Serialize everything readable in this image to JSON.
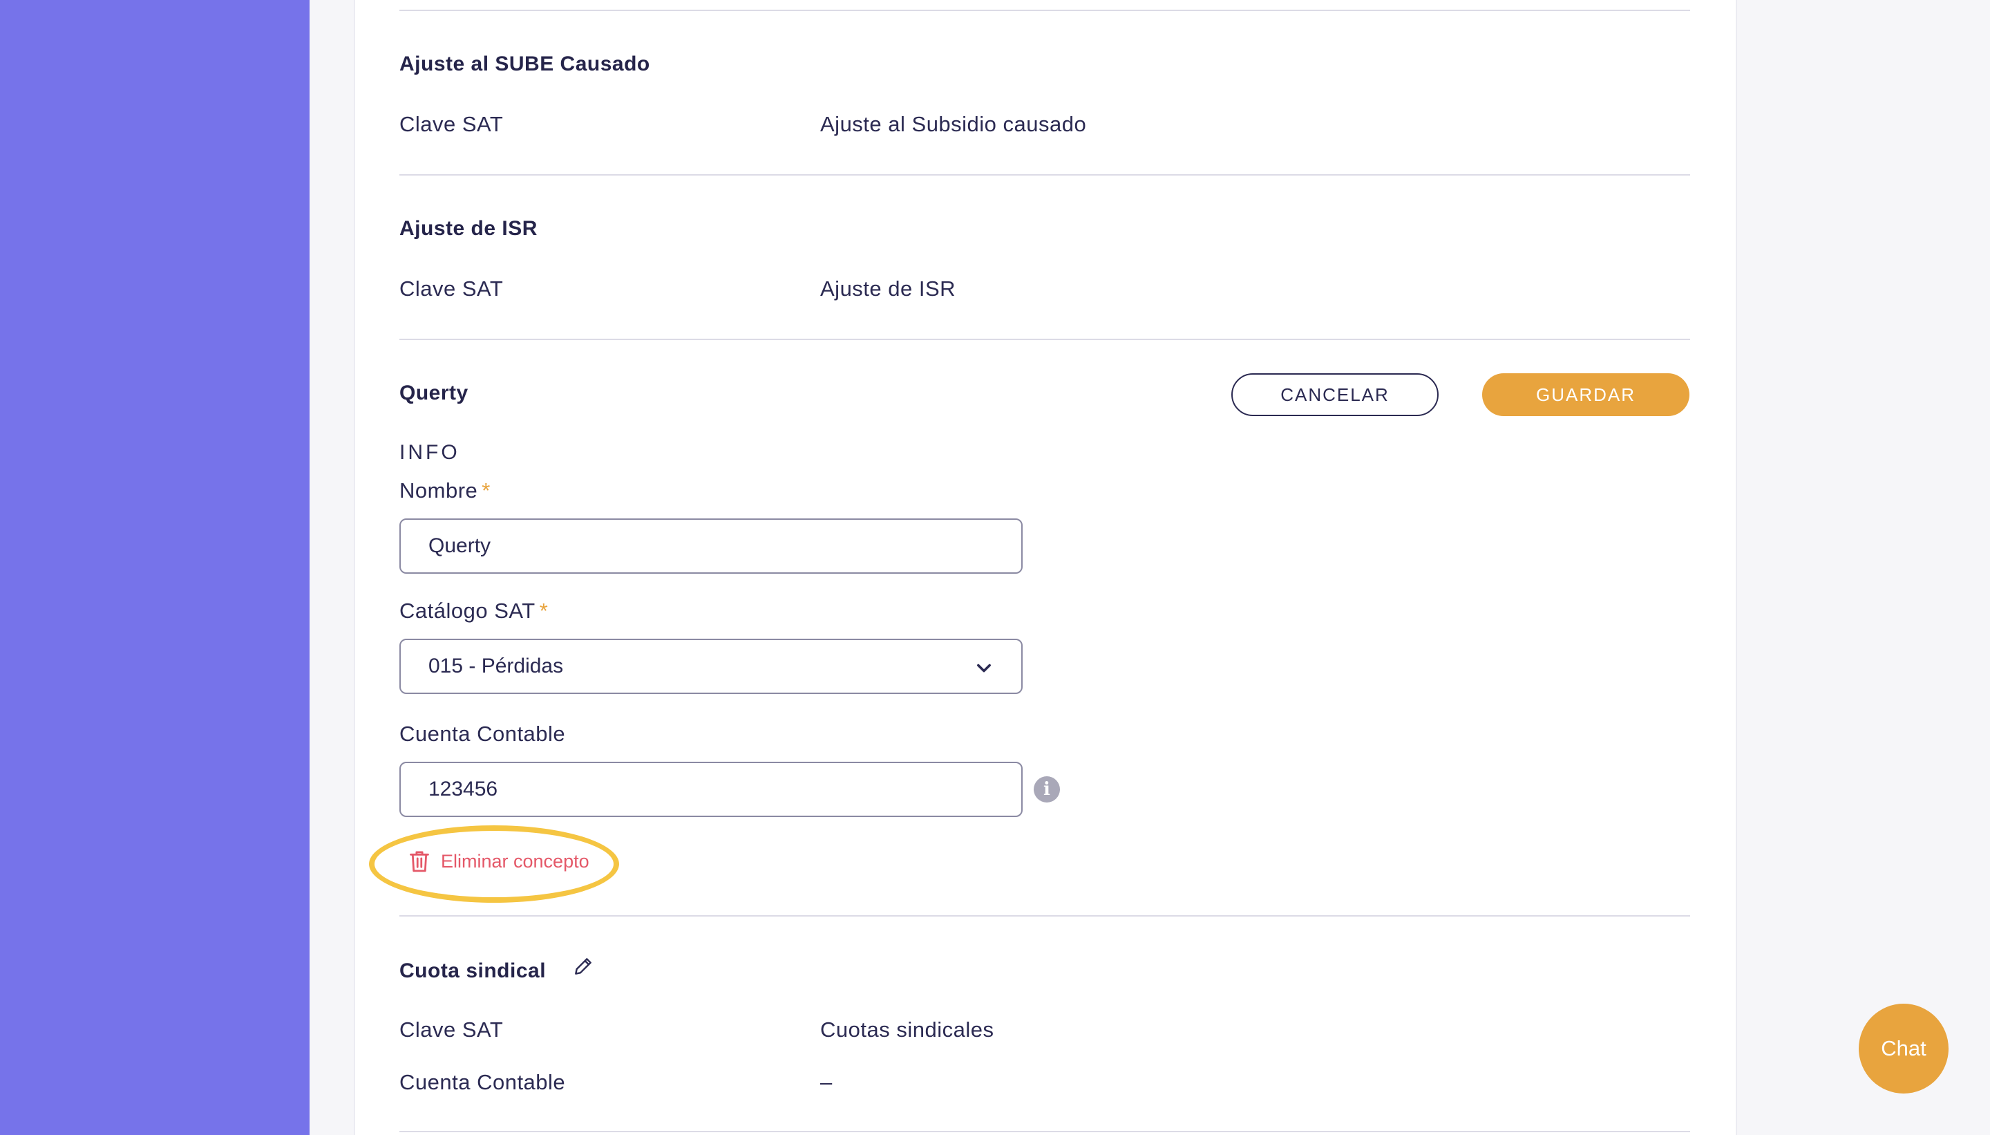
{
  "sections": {
    "sube": {
      "title": "Ajuste al SUBE Causado",
      "clave_label": "Clave SAT",
      "clave_value": "Ajuste al Subsidio causado"
    },
    "isr": {
      "title": "Ajuste de ISR",
      "clave_label": "Clave SAT",
      "clave_value": "Ajuste de ISR"
    },
    "querty": {
      "title": "Querty",
      "cancel_label": "CANCELAR",
      "save_label": "GUARDAR",
      "info_label": "INFO",
      "nombre_label": "Nombre",
      "nombre_value": "Querty",
      "catalogo_label": "Catálogo SAT",
      "catalogo_value": "015 - Pérdidas",
      "cuenta_label": "Cuenta Contable",
      "cuenta_value": "123456",
      "required_mark": "*",
      "info_icon_glyph": "i",
      "delete_label": "Eliminar concepto"
    },
    "cuota": {
      "title": "Cuota sindical",
      "clave_label": "Clave SAT",
      "clave_value": "Cuotas sindicales",
      "cuenta_label": "Cuenta Contable",
      "cuenta_value": "–"
    }
  },
  "chat": {
    "label": "Chat"
  },
  "icons": {
    "delete": "trash-icon",
    "edit": "pencil-icon",
    "info": "info-icon",
    "chevron": "chevron-down-icon"
  },
  "colors": {
    "sidebar": "#7673ea",
    "accent": "#e8a43e",
    "danger": "#e45868",
    "highlight": "#f5c542",
    "text": "#2b2a52"
  }
}
